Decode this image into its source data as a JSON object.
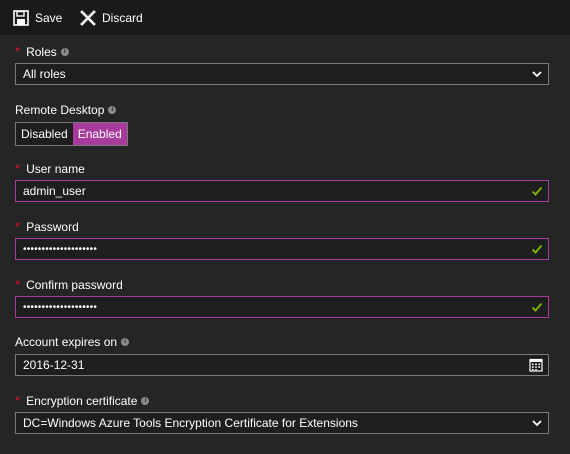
{
  "toolbar": {
    "save_label": "Save",
    "discard_label": "Discard"
  },
  "roles": {
    "label": "Roles",
    "value": "All roles"
  },
  "remote_desktop": {
    "label": "Remote Desktop",
    "options": [
      "Disabled",
      "Enabled"
    ],
    "selected": "Enabled"
  },
  "user_name": {
    "label": "User name",
    "value": "admin_user"
  },
  "password": {
    "label": "Password",
    "value": "••••••••••••••••••••"
  },
  "confirm_password": {
    "label": "Confirm password",
    "value": "••••••••••••••••••••"
  },
  "account_expires": {
    "label": "Account expires on",
    "value": "2016-12-31"
  },
  "encryption_certificate": {
    "label": "Encryption certificate",
    "value": "DC=Windows Azure Tools Encryption Certificate for Extensions"
  },
  "colors": {
    "accent": "#a83a9b",
    "required": "#e81123",
    "valid": "#7fba00",
    "background": "#252525"
  }
}
